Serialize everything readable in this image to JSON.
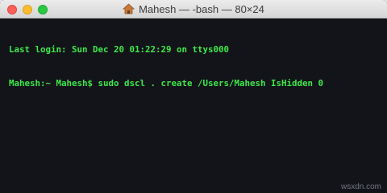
{
  "window": {
    "title": "Mahesh — -bash — 80×24",
    "title_icon": "home-folder-icon"
  },
  "terminal": {
    "lines": [
      "Last login: Sun Dec 20 01:22:29 on ttys000",
      "Mahesh:~ Mahesh$ sudo dscl . create /Users/Mahesh IsHidden 0"
    ],
    "text_color": "#3ee84a",
    "background_color": "#121419"
  },
  "watermark": "wsxdn.com",
  "colors": {
    "close": "#fc5f57",
    "minimize": "#fdbc2e",
    "maximize": "#2ac840"
  }
}
